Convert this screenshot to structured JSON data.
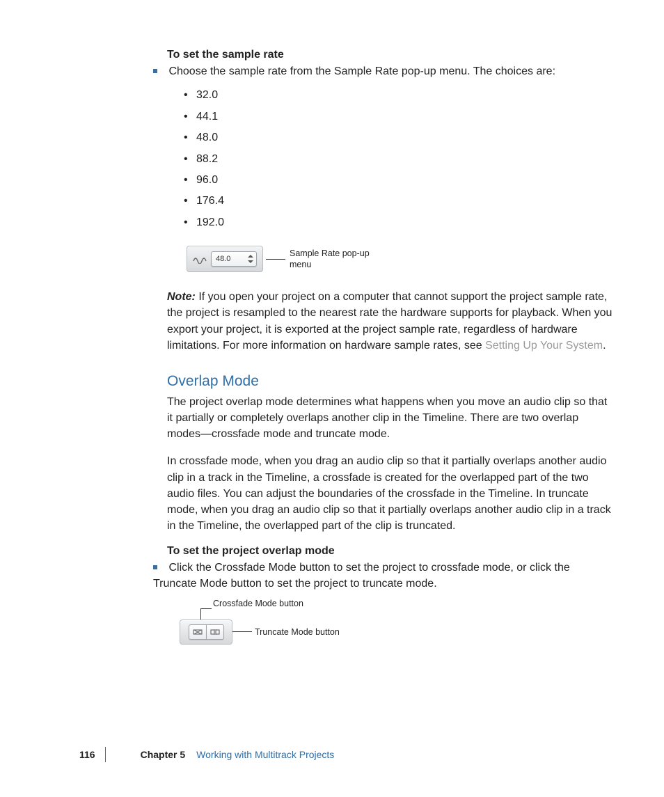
{
  "section1": {
    "heading": "To set the sample rate",
    "bullet_intro": "Choose the sample rate from the Sample Rate pop-up menu. The choices are:",
    "rates": [
      "32.0",
      "44.1",
      "48.0",
      "88.2",
      "96.0",
      "176.4",
      "192.0"
    ],
    "popup_value": "48.0",
    "callout": "Sample Rate pop-up menu"
  },
  "note": {
    "label": "Note:",
    "text_before_link": "If you open your project on a computer that cannot support the project sample rate, the project is resampled to the nearest rate the hardware supports for playback. When you export your project, it is exported at the project sample rate, regardless of hardware limitations. For more information on hardware sample rates, see ",
    "link_text": "Setting Up Your System",
    "text_after_link": "."
  },
  "overlap": {
    "heading": "Overlap Mode",
    "para1": "The project overlap mode determines what happens when you move an audio clip so that it partially or completely overlaps another clip in the Timeline. There are two overlap modes—crossfade mode and truncate mode.",
    "para2": "In crossfade mode, when you drag an audio clip so that it partially overlaps another audio clip in a track in the Timeline, a crossfade is created for the overlapped part of the two audio files. You can adjust the boundaries of the crossfade in the Timeline. In truncate mode, when you drag an audio clip so that it partially overlaps another audio clip in a track in the Timeline, the overlapped part of the clip is truncated.",
    "subheading": "To set the project overlap mode",
    "bullet": "Click the Crossfade Mode button to set the project to crossfade mode, or click the Truncate Mode button to set the project to truncate mode.",
    "label_crossfade": "Crossfade Mode button",
    "label_truncate": "Truncate Mode button"
  },
  "footer": {
    "page": "116",
    "chapter_label": "Chapter 5",
    "chapter_title": "Working with Multitrack Projects"
  }
}
